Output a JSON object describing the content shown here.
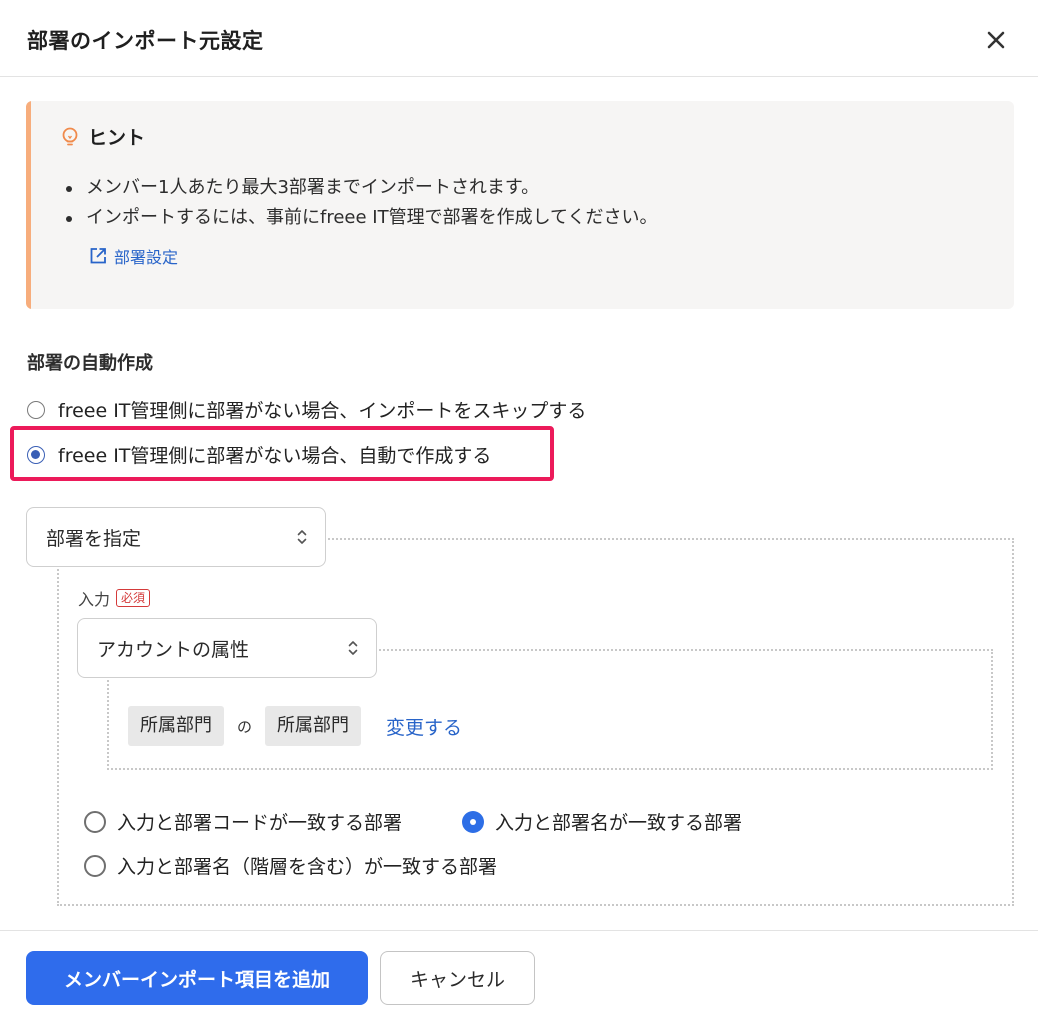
{
  "dialog": {
    "title": "部署のインポート元設定"
  },
  "hint": {
    "title": "ヒント",
    "items": [
      "メンバー1人あたり最大3部署までインポートされます。",
      "インポートするには、事前にfreee IT管理で部署を作成してください。"
    ],
    "link_label": "部署設定",
    "accent_color": "#f7ad7c"
  },
  "auto_create": {
    "label": "部署の自動作成",
    "options": [
      {
        "label": "freee IT管理側に部署がない場合、インポートをスキップする",
        "checked": false
      },
      {
        "label": "freee IT管理側に部署がない場合、自動で作成する",
        "checked": true
      }
    ],
    "highlight_color": "#ec1a5a"
  },
  "department_select": {
    "value": "部署を指定"
  },
  "input": {
    "label": "入力",
    "required_badge": "必須",
    "select_value": "アカウントの属性",
    "chip_left": "所属部門",
    "connector": "の",
    "chip_right": "所属部門",
    "change_link": "変更する"
  },
  "match_options": [
    {
      "label": "入力と部署コードが一致する部署",
      "checked": false
    },
    {
      "label": "入力と部署名が一致する部署",
      "checked": true
    },
    {
      "label": "入力と部署名（階層を含む）が一致する部署",
      "checked": false
    }
  ],
  "footer": {
    "primary_label": "メンバーインポート項目を追加",
    "secondary_label": "キャンセル",
    "primary_color": "#2f6cec"
  },
  "link_color": "#2864c9"
}
